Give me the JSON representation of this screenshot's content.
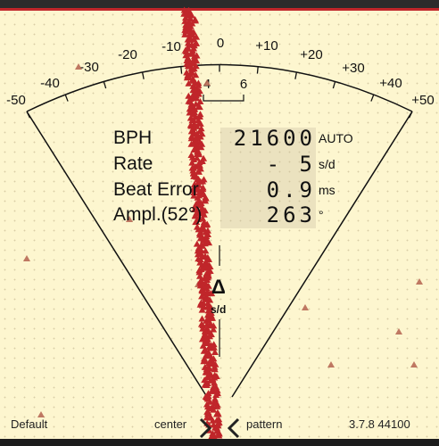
{
  "scale": {
    "labels": [
      "-50",
      "-40",
      "-30",
      "-20",
      "-10",
      "0",
      "+10",
      "+20",
      "+30",
      "+40",
      "+50"
    ],
    "sub_labels": [
      "4",
      "6"
    ]
  },
  "stats": {
    "bph": {
      "label": "BPH",
      "value": "21600",
      "unit": "AUTO"
    },
    "rate": {
      "label": "Rate",
      "value": "- 5",
      "unit": "s/d"
    },
    "beat_error": {
      "label": "Beat Error",
      "value": "0.9",
      "unit": "ms"
    },
    "amplitude": {
      "label": "Ampl.(52°)",
      "value": "263",
      "unit": "°"
    }
  },
  "delta": {
    "symbol": "Δ",
    "unit": "s/d"
  },
  "footer": {
    "left": "Default",
    "center_left": "center",
    "center_right": "pattern",
    "right": "3.7.8 44100"
  },
  "colors": {
    "background": "#fdf6cf",
    "trace": "#c0262a",
    "marker": "#b86a55",
    "text": "#111111"
  }
}
